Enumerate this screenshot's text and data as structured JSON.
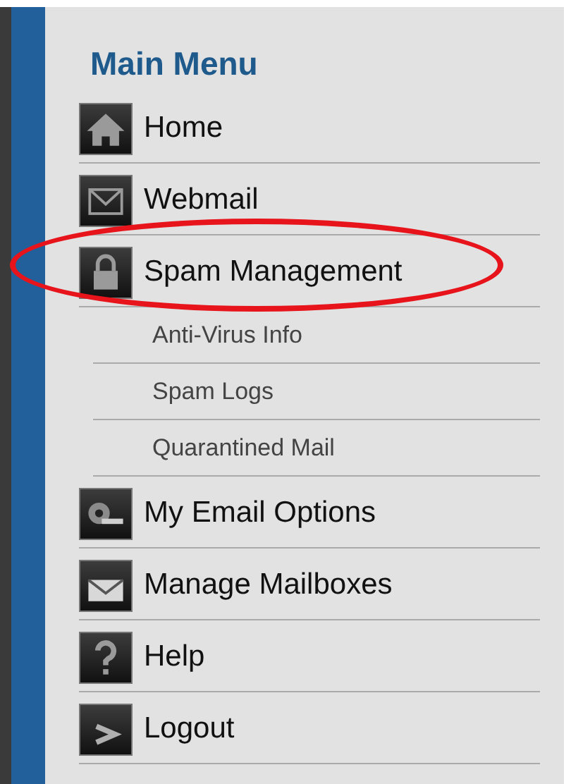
{
  "menu": {
    "title": "Main Menu",
    "items": [
      {
        "kind": "main",
        "label": "Home",
        "circled": false
      },
      {
        "kind": "main",
        "label": "Webmail",
        "circled": false
      },
      {
        "kind": "main",
        "label": "Spam Management",
        "circled": true
      },
      {
        "kind": "sub",
        "label": "Anti-Virus Info",
        "circled": false
      },
      {
        "kind": "sub",
        "label": "Spam Logs",
        "circled": false
      },
      {
        "kind": "sub",
        "label": "Quarantined Mail",
        "circled": false
      },
      {
        "kind": "main",
        "label": "My Email Options",
        "circled": false
      },
      {
        "kind": "main",
        "label": "Manage Mailboxes",
        "circled": false
      },
      {
        "kind": "main",
        "label": "Help",
        "circled": false
      },
      {
        "kind": "main",
        "label": "Logout",
        "circled": false
      }
    ]
  }
}
